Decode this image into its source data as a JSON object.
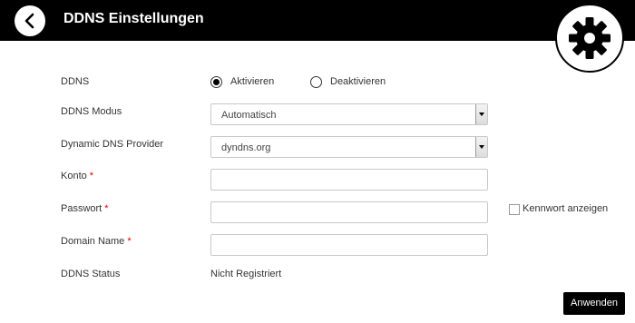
{
  "header": {
    "title": "DDNS Einstellungen",
    "back_icon": "chevron-left-icon",
    "settings_icon": "gear-icon"
  },
  "form": {
    "ddns": {
      "label": "DDNS",
      "options": [
        {
          "label": "Aktivieren",
          "checked": true
        },
        {
          "label": "Deaktivieren",
          "checked": false
        }
      ]
    },
    "mode": {
      "label": "DDNS Modus",
      "value": "Automatisch"
    },
    "provider": {
      "label": "Dynamic DNS Provider",
      "value": "dyndns.org"
    },
    "account": {
      "label": "Konto",
      "required": "*",
      "value": ""
    },
    "password": {
      "label": "Passwort",
      "required": "*",
      "value": "",
      "show_label": "Kennwort anzeigen",
      "show_checked": false
    },
    "domain": {
      "label": "Domain Name",
      "required": "*",
      "value": ""
    },
    "status": {
      "label": "DDNS Status",
      "value": "Nicht Registriert"
    }
  },
  "actions": {
    "apply_label": "Anwenden"
  },
  "colors": {
    "header_bg": "#000000",
    "required": "#dd0000",
    "button_bg": "#000000"
  }
}
